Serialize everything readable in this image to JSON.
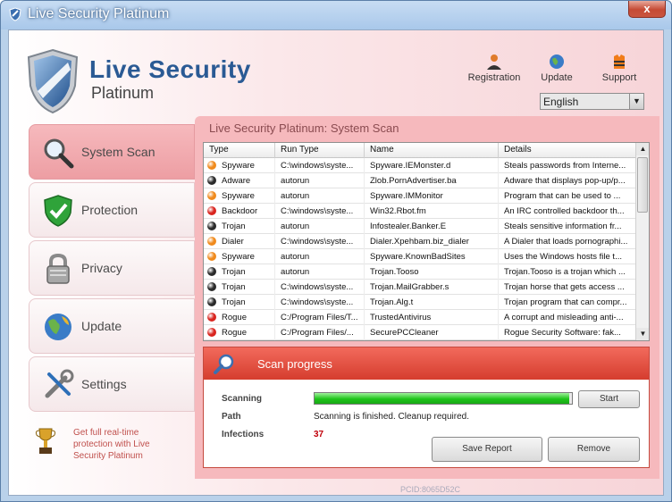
{
  "window": {
    "title": "Live Security Platinum",
    "close_glyph": "x"
  },
  "brand": {
    "line1": "Live Security",
    "line2": "Platinum",
    "logo_icon": "shield-logo-icon"
  },
  "toplinks": [
    {
      "label": "Registration",
      "icon": "user-icon"
    },
    {
      "label": "Update",
      "icon": "globe-icon"
    },
    {
      "label": "Support",
      "icon": "lifejacket-icon"
    }
  ],
  "language": {
    "selected": "English"
  },
  "nav": [
    {
      "label": "System Scan",
      "icon": "magnifier-icon",
      "active": true
    },
    {
      "label": "Protection",
      "icon": "shield-check-icon",
      "active": false
    },
    {
      "label": "Privacy",
      "icon": "padlock-icon",
      "active": false
    },
    {
      "label": "Update",
      "icon": "globe-icon",
      "active": false
    },
    {
      "label": "Settings",
      "icon": "tools-icon",
      "active": false
    }
  ],
  "promo": {
    "text": "Get full real-time protection with Live Security Platinum",
    "icon": "trophy-icon"
  },
  "panel": {
    "title": "Live Security Platinum: System Scan"
  },
  "table": {
    "columns": [
      "Type",
      "Run Type",
      "Name",
      "Details"
    ],
    "rows": [
      {
        "type": "Spyware",
        "dot": "#f08a1c",
        "run": "C:\\windows\\syste...",
        "name": "Spyware.IEMonster.d",
        "details": "Steals passwords from Interne..."
      },
      {
        "type": "Adware",
        "dot": "#2a2a2a",
        "run": "autorun",
        "name": "Zlob.PornAdvertiser.ba",
        "details": "Adware that displays pop-up/p..."
      },
      {
        "type": "Spyware",
        "dot": "#f08a1c",
        "run": "autorun",
        "name": "Spyware.IMMonitor",
        "details": "Program that can be used to ..."
      },
      {
        "type": "Backdoor",
        "dot": "#d9251f",
        "run": "C:\\windows\\syste...",
        "name": "Win32.Rbot.fm",
        "details": "An IRC controlled backdoor th..."
      },
      {
        "type": "Trojan",
        "dot": "#2a2a2a",
        "run": "autorun",
        "name": "Infostealer.Banker.E",
        "details": "Steals sensitive information fr..."
      },
      {
        "type": "Dialer",
        "dot": "#f08a1c",
        "run": "C:\\windows\\syste...",
        "name": "Dialer.Xpehbam.biz_dialer",
        "details": "A Dialer that loads pornographi..."
      },
      {
        "type": "Spyware",
        "dot": "#f08a1c",
        "run": "autorun",
        "name": "Spyware.KnownBadSites",
        "details": "Uses the Windows hosts file t..."
      },
      {
        "type": "Trojan",
        "dot": "#2a2a2a",
        "run": "autorun",
        "name": "Trojan.Tooso",
        "details": "Trojan.Tooso is a trojan which ..."
      },
      {
        "type": "Trojan",
        "dot": "#2a2a2a",
        "run": "C:\\windows\\syste...",
        "name": "Trojan.MailGrabber.s",
        "details": "Trojan horse that gets access ..."
      },
      {
        "type": "Trojan",
        "dot": "#2a2a2a",
        "run": "C:\\windows\\syste...",
        "name": "Trojan.Alg.t",
        "details": "Trojan program that can compr..."
      },
      {
        "type": "Rogue",
        "dot": "#d9251f",
        "run": "C:/Program Files/T...",
        "name": "TrustedAntivirus",
        "details": "A corrupt and misleading anti-..."
      },
      {
        "type": "Rogue",
        "dot": "#d9251f",
        "run": "C:/Program Files/...",
        "name": "SecurePCCleaner",
        "details": "Rogue Security Software: fak..."
      }
    ]
  },
  "scan": {
    "title": "Scan progress",
    "scanning_label": "Scanning",
    "progress_fraction": 0.99,
    "path_label": "Path",
    "path_value": "Scanning is finished. Cleanup required.",
    "infections_label": "Infections",
    "infections_value": "37",
    "start_label": "Start",
    "save_label": "Save Report",
    "remove_label": "Remove"
  },
  "footer": {
    "pcid": "PCID:8065D52C"
  },
  "colors": {
    "accent_red": "#d53d2e",
    "brand_blue": "#2a5a94",
    "infections_red": "#c0000a"
  }
}
